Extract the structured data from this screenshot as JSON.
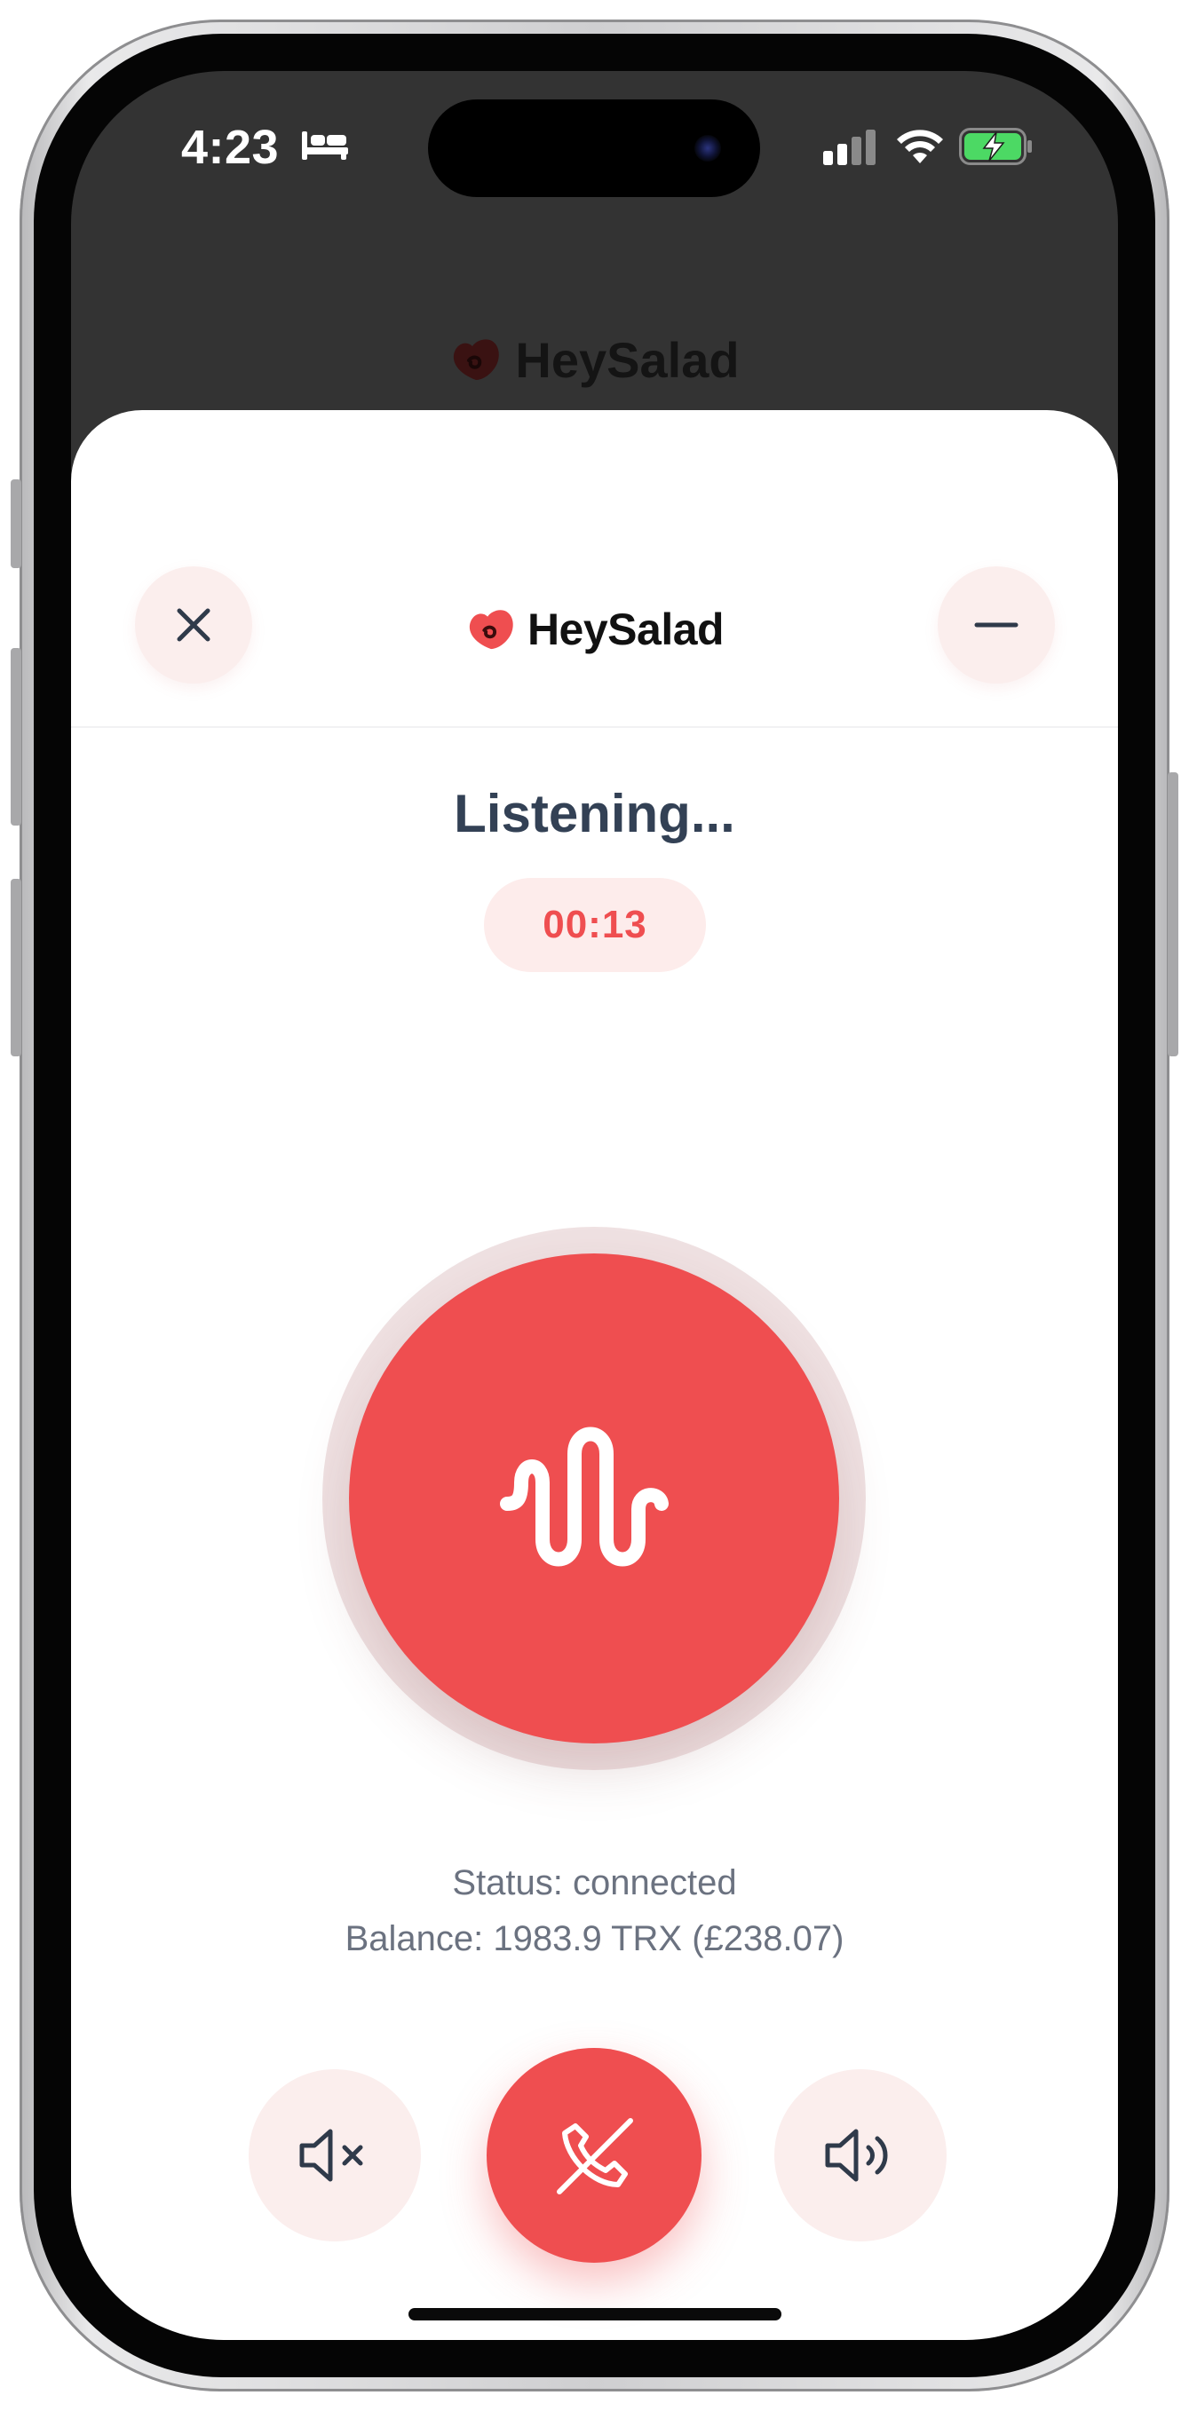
{
  "status_bar": {
    "time": "4:23",
    "icons": [
      "sleep-bed-icon",
      "cellular-signal-icon",
      "wifi-icon",
      "battery-charging-icon"
    ]
  },
  "app": {
    "brand_name": "HeySalad",
    "background_brand_name": "HeySalad",
    "brand_color": "#ef4e50"
  },
  "header": {
    "close_icon": "close-icon",
    "minimize_icon": "minimize-icon"
  },
  "call": {
    "title": "Listening...",
    "timer": "00:13",
    "status_text": "Status: connected",
    "balance_text": "Balance: 1983.9 TRX (£238.07)"
  },
  "controls": {
    "mute_icon": "speaker-muted-icon",
    "end_call_icon": "phone-end-icon",
    "speaker_icon": "speaker-on-icon",
    "mic_icon": "sound-wave-icon"
  },
  "colors": {
    "accent": "#ef4e50",
    "button_bg": "#fbeeed",
    "text_dark": "#334155",
    "text_muted": "#6b7280"
  }
}
